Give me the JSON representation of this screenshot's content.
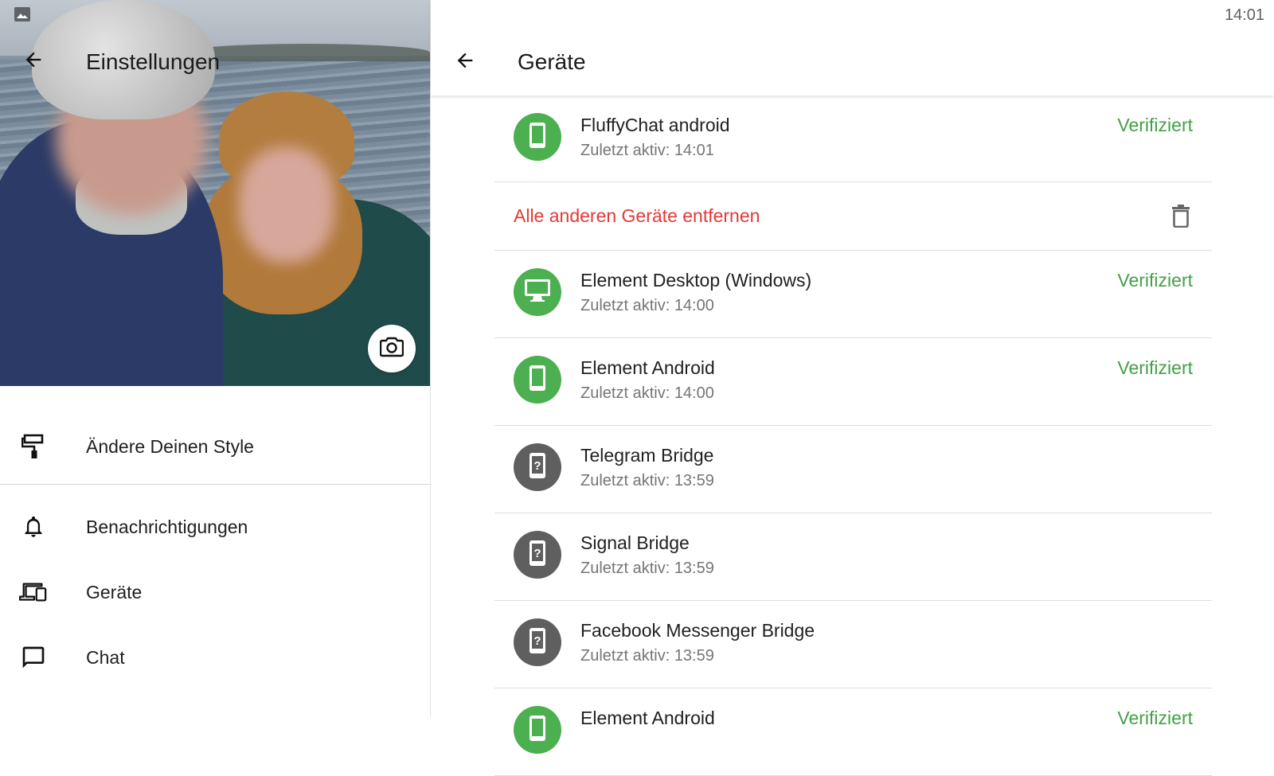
{
  "status_bar": {
    "time": "14:01",
    "left_icon": "image-icon"
  },
  "settings": {
    "title": "Einstellungen",
    "back_icon": "arrow-back-icon",
    "camera_icon": "camera-icon",
    "menu": [
      {
        "label": "Ändere Deinen Style",
        "icon": "paint-roller-icon"
      },
      {
        "label": "Benachrichtigungen",
        "icon": "bell-icon"
      },
      {
        "label": "Geräte",
        "icon": "devices-icon"
      },
      {
        "label": "Chat",
        "icon": "chat-bubble-icon"
      }
    ]
  },
  "devices": {
    "title": "Geräte",
    "back_icon": "arrow-back-icon",
    "current": {
      "name": "FluffyChat android",
      "last_active": "Zuletzt aktiv: 14:01",
      "status": "Verifiziert",
      "icon": "phone-icon"
    },
    "remove_all_label": "Alle anderen Geräte entfernen",
    "remove_icon": "trash-icon",
    "items": [
      {
        "name": "Element Desktop (Windows)",
        "last_active": "Zuletzt aktiv: 14:00",
        "status": "Verifiziert",
        "icon": "desktop-icon",
        "color": "#4caf50"
      },
      {
        "name": "Element Android",
        "last_active": "Zuletzt aktiv: 14:00",
        "status": "Verifiziert",
        "icon": "phone-icon",
        "color": "#4caf50"
      },
      {
        "name": "Telegram Bridge",
        "last_active": "Zuletzt aktiv: 13:59",
        "status": "",
        "icon": "unknown-device-icon",
        "color": "#5f5f5f"
      },
      {
        "name": "Signal Bridge",
        "last_active": "Zuletzt aktiv: 13:59",
        "status": "",
        "icon": "unknown-device-icon",
        "color": "#5f5f5f"
      },
      {
        "name": "Facebook Messenger Bridge",
        "last_active": "Zuletzt aktiv: 13:59",
        "status": "",
        "icon": "unknown-device-icon",
        "color": "#5f5f5f"
      },
      {
        "name": "Element Android",
        "last_active": "",
        "status": "Verifiziert",
        "icon": "phone-icon",
        "color": "#4caf50"
      }
    ]
  },
  "colors": {
    "verified": "#43a047",
    "danger": "#e53935",
    "avatar_green": "#4caf50",
    "avatar_grey": "#5f5f5f"
  }
}
